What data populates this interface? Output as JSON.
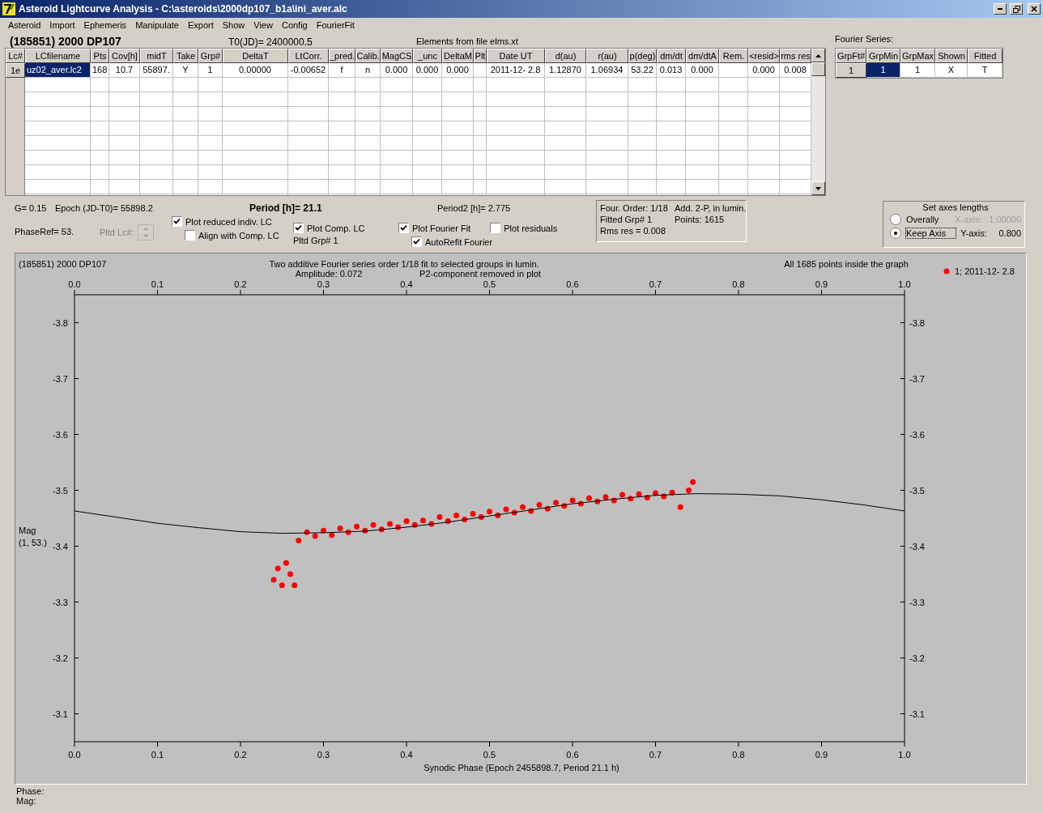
{
  "window": {
    "title": "Asteroid Lightcurve Analysis - C:\\asteroids\\2000dp107_b1a\\ini_aver.alc"
  },
  "menu": [
    "Asteroid",
    "Import",
    "Ephemeris",
    "Manipulate",
    "Export",
    "Show",
    "View",
    "Config",
    "FourierFit"
  ],
  "header": {
    "object": "(185851) 2000 DP107",
    "t0": "T0(JD)= 2400000.5",
    "elements": "Elements from file elms.xt",
    "fourier_title": "Fourier Series:"
  },
  "lc_table": {
    "columns": [
      "Lc#",
      "LCfilename",
      "Pts",
      "Cov[h]",
      "midT",
      "Take",
      "Grp#",
      "DeltaT",
      "LtCorr.",
      "_pred.",
      "Calib.",
      "MagCS",
      "_unc",
      "DeltaM",
      "Plt",
      "Date UT",
      "d(au)",
      "r(au)",
      "p(deg)",
      "dm/dt",
      "dm/dtA",
      "Rem.",
      "<resid>",
      "rms res"
    ],
    "rows": [
      {
        "cells": [
          {
            "text": "1e",
            "selected": false
          },
          {
            "text": "uz02_aver.lc2",
            "selected": true
          },
          {
            "text": "168",
            "selected": false
          },
          {
            "text": "10.7",
            "selected": false
          },
          {
            "text": "55897.",
            "selected": false
          },
          {
            "text": "Y",
            "selected": false
          },
          {
            "text": "1",
            "selected": false
          },
          {
            "text": "0.00000",
            "selected": false
          },
          {
            "text": "-0.00652",
            "selected": false
          },
          {
            "text": "f",
            "selected": false
          },
          {
            "text": "n",
            "selected": false
          },
          {
            "text": "0.000",
            "selected": false
          },
          {
            "text": "0.000",
            "selected": false
          },
          {
            "text": "0.000",
            "selected": false
          },
          {
            "selected": false
          },
          {
            "text": "2011-12- 2.8",
            "selected": false
          },
          {
            "text": "1.12870",
            "selected": false
          },
          {
            "text": "1.06934",
            "selected": false
          },
          {
            "text": "53.22",
            "selected": false
          },
          {
            "text": "0.013",
            "selected": false
          },
          {
            "text": "0.000",
            "selected": false
          },
          {
            "selected": false
          },
          {
            "text": "0.000",
            "selected": false
          },
          {
            "text": "0.008",
            "selected": false
          }
        ]
      }
    ]
  },
  "fourier_table": {
    "columns": [
      "GrpFt#",
      "GrpMin",
      "GrpMax",
      "Shown",
      "Fitted"
    ],
    "rows": [
      {
        "cells": [
          {
            "text": "1",
            "selected": false
          },
          {
            "text": "1",
            "selected": true
          },
          {
            "text": "1",
            "selected": false
          },
          {
            "text": "X",
            "selected": false
          },
          {
            "text": "T",
            "selected": false
          }
        ]
      }
    ]
  },
  "params": {
    "g": "G= 0.15",
    "epoch": "Epoch (JD-T0)= 55898.2",
    "period": "Period [h]= 21.1",
    "period2": "Period2 [h]= 2.775",
    "phase_ref": "PhaseRef= 53.",
    "pltd_lc": {
      "label": "Pltd Lc#:",
      "disabled": true
    },
    "pltd_grp": "Pltd Grp#  1"
  },
  "checkboxes": [
    {
      "label": "Plot reduced indiv. LC",
      "checked": true
    },
    {
      "label": "Align with Comp. LC",
      "checked": false
    },
    {
      "label": "Plot Comp. LC",
      "checked": true
    },
    {
      "label": "Plot Fourier Fit",
      "checked": true
    },
    {
      "label": "Plot residuals",
      "checked": false
    },
    {
      "label": "AutoRefit Fourier",
      "checked": true
    }
  ],
  "fourier_info": [
    "Four. Order:  1/18",
    "Add. 2-P, in lumin.",
    "Fitted Grp# 1",
    "Points: 1615",
    "Rms res     = 0.008"
  ],
  "axes_group": {
    "title": "Set axes lengths",
    "options": [
      {
        "label": "Overally",
        "selected": false
      },
      {
        "label": "Keep Axis",
        "selected": true
      }
    ],
    "fields": [
      {
        "label": "X-axis:",
        "value": "1.00000",
        "disabled": true
      },
      {
        "label": "Y-axis:",
        "value": "0.800",
        "disabled": false
      }
    ]
  },
  "plot": {
    "object": "(185851) 2000 DP107",
    "subtitle": "Two additive Fourier series order 1/18 fit to selected groups in lumin.",
    "amplitude": "Amplitude: 0.072",
    "p2_note": "P2-component removed in plot",
    "points_note": "All 1685 points inside the graph",
    "ylabel_sub": "(1, 53.)",
    "chart_data": {
      "type": "scatter",
      "xlabel": "Synodic Phase (Epoch 2455898.7, Period 21.1 h)",
      "ylabel": "Mag",
      "xlim": [
        0,
        1
      ],
      "ylim": [
        -3.05,
        -3.85
      ],
      "xticks": [
        {
          "value": 0,
          "label": "0.0"
        },
        {
          "value": 0.1,
          "label": "0.1"
        },
        {
          "value": 0.2,
          "label": "0.2"
        },
        {
          "value": 0.3,
          "label": "0.3"
        },
        {
          "value": 0.4,
          "label": "0.4"
        },
        {
          "value": 0.5,
          "label": "0.5"
        },
        {
          "value": 0.6,
          "label": "0.6"
        },
        {
          "value": 0.7,
          "label": "0.7"
        },
        {
          "value": 0.8,
          "label": "0.8"
        },
        {
          "value": 0.9,
          "label": "0.9"
        },
        {
          "value": 1,
          "label": "1.0"
        }
      ],
      "yticks": [
        {
          "value": -3.8,
          "label": "-3.8"
        },
        {
          "value": -3.7,
          "label": "-3.7"
        },
        {
          "value": -3.6,
          "label": "-3.6"
        },
        {
          "value": -3.5,
          "label": "-3.5"
        },
        {
          "value": -3.4,
          "label": "-3.4"
        },
        {
          "value": -3.3,
          "label": "-3.3"
        },
        {
          "value": -3.2,
          "label": "-3.2"
        },
        {
          "value": -3.1,
          "label": "-3.1"
        }
      ],
      "series": [
        {
          "name": "1; 2011-12- 2.8",
          "color": "#ff0000",
          "x": [
            0.24,
            0.245,
            0.25,
            0.255,
            0.26,
            0.265,
            0.27,
            0.28,
            0.29,
            0.3,
            0.31,
            0.32,
            0.33,
            0.34,
            0.35,
            0.36,
            0.37,
            0.38,
            0.39,
            0.4,
            0.41,
            0.42,
            0.43,
            0.44,
            0.45,
            0.46,
            0.47,
            0.48,
            0.49,
            0.5,
            0.51,
            0.52,
            0.53,
            0.54,
            0.55,
            0.56,
            0.57,
            0.58,
            0.59,
            0.6,
            0.61,
            0.62,
            0.63,
            0.64,
            0.65,
            0.66,
            0.67,
            0.68,
            0.69,
            0.7,
            0.71,
            0.72,
            0.73,
            0.74,
            0.745
          ],
          "values": [
            -3.34,
            -3.36,
            -3.33,
            -3.37,
            -3.35,
            -3.33,
            -3.41,
            -3.425,
            -3.418,
            -3.428,
            -3.42,
            -3.432,
            -3.425,
            -3.435,
            -3.428,
            -3.438,
            -3.43,
            -3.44,
            -3.434,
            -3.445,
            -3.438,
            -3.446,
            -3.44,
            -3.452,
            -3.445,
            -3.455,
            -3.448,
            -3.458,
            -3.452,
            -3.462,
            -3.455,
            -3.466,
            -3.46,
            -3.47,
            -3.463,
            -3.474,
            -3.467,
            -3.478,
            -3.472,
            -3.482,
            -3.476,
            -3.486,
            -3.48,
            -3.488,
            -3.482,
            -3.492,
            -3.485,
            -3.493,
            -3.487,
            -3.495,
            -3.489,
            -3.496,
            -3.47,
            -3.5,
            -3.515
          ]
        },
        {
          "type": "line",
          "color": "#000000",
          "x": [
            0,
            0.05,
            0.1,
            0.15,
            0.2,
            0.25,
            0.3,
            0.35,
            0.4,
            0.45,
            0.5,
            0.55,
            0.6,
            0.65,
            0.7,
            0.75,
            0.8,
            0.85,
            0.9,
            0.95,
            1
          ],
          "values": [
            -3.463,
            -3.452,
            -3.441,
            -3.433,
            -3.426,
            -3.423,
            -3.424,
            -3.427,
            -3.434,
            -3.443,
            -3.454,
            -3.465,
            -3.476,
            -3.484,
            -3.491,
            -3.494,
            -3.493,
            -3.49,
            -3.483,
            -3.474,
            -3.463
          ]
        }
      ]
    }
  },
  "status": [
    "Phase:",
    "Mag:"
  ]
}
